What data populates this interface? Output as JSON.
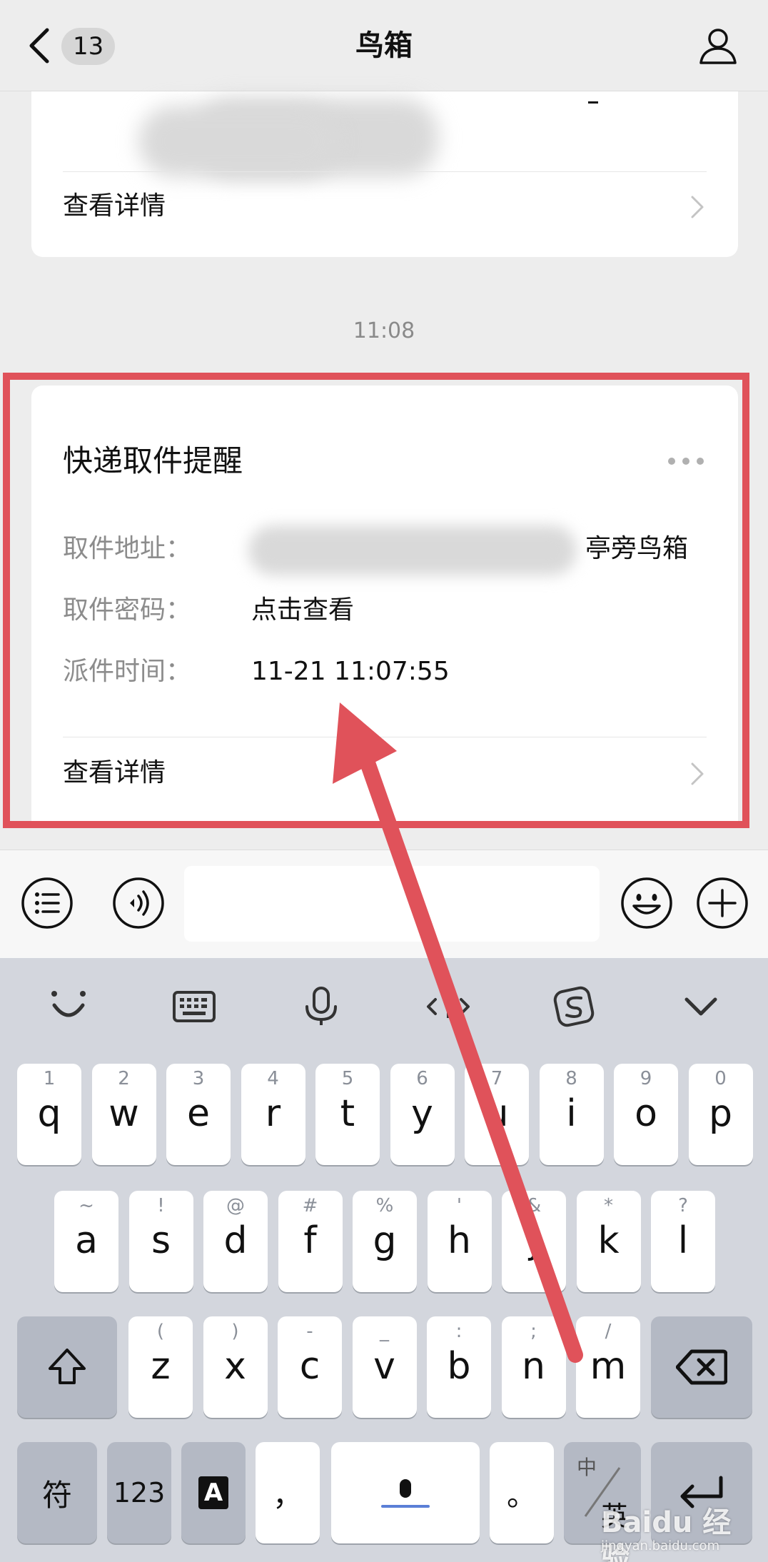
{
  "header": {
    "unread_count": "13",
    "title": "鸟箱",
    "back_icon": "chevron-left-icon",
    "profile_icon": "person-icon"
  },
  "messages": [
    {
      "detail_link": "查看详情"
    },
    {
      "time": "11:08"
    },
    {
      "card_title": "快递取件提醒",
      "fields": [
        {
          "label": "取件地址：",
          "value": "亭旁鸟箱"
        },
        {
          "label": "取件密码：",
          "value": "点击查看"
        },
        {
          "label": "派件时间：",
          "value": "11-21 11:07:55"
        }
      ],
      "detail_link": "查看详情"
    }
  ],
  "input_bar": {
    "placeholder": "",
    "icons": [
      "menu-list-icon",
      "voice-icon",
      "emoji-icon",
      "plus-icon"
    ]
  },
  "keyboard": {
    "toolbar_icons": [
      "smile-icon",
      "keyboard-icon",
      "microphone-icon",
      "cursor-move-icon",
      "sogou-logo-icon",
      "collapse-icon"
    ],
    "row1": [
      {
        "hint": "1",
        "key": "q"
      },
      {
        "hint": "2",
        "key": "w"
      },
      {
        "hint": "3",
        "key": "e"
      },
      {
        "hint": "4",
        "key": "r"
      },
      {
        "hint": "5",
        "key": "t"
      },
      {
        "hint": "6",
        "key": "y"
      },
      {
        "hint": "7",
        "key": "u"
      },
      {
        "hint": "8",
        "key": "i"
      },
      {
        "hint": "9",
        "key": "o"
      },
      {
        "hint": "0",
        "key": "p"
      }
    ],
    "row2": [
      {
        "hint": "~",
        "key": "a"
      },
      {
        "hint": "!",
        "key": "s"
      },
      {
        "hint": "@",
        "key": "d"
      },
      {
        "hint": "#",
        "key": "f"
      },
      {
        "hint": "%",
        "key": "g"
      },
      {
        "hint": "'",
        "key": "h"
      },
      {
        "hint": "&",
        "key": "j"
      },
      {
        "hint": "*",
        "key": "k"
      },
      {
        "hint": "?",
        "key": "l"
      }
    ],
    "row3": [
      {
        "hint": "(",
        "key": "z"
      },
      {
        "hint": ")",
        "key": "x"
      },
      {
        "hint": "-",
        "key": "c"
      },
      {
        "hint": "_",
        "key": "v"
      },
      {
        "hint": ":",
        "key": "b"
      },
      {
        "hint": ";",
        "key": "n"
      },
      {
        "hint": "/",
        "key": "m"
      }
    ],
    "symbol_key": "符",
    "number_key": "123",
    "font_key": "A",
    "comma_key": "，",
    "period_key": "。",
    "lang_key_top": "中",
    "lang_key_bottom": "英"
  },
  "watermark": {
    "text": "Baidu 经验",
    "url": "jingyan.baidu.com"
  },
  "annotation_color": "#e0525a"
}
